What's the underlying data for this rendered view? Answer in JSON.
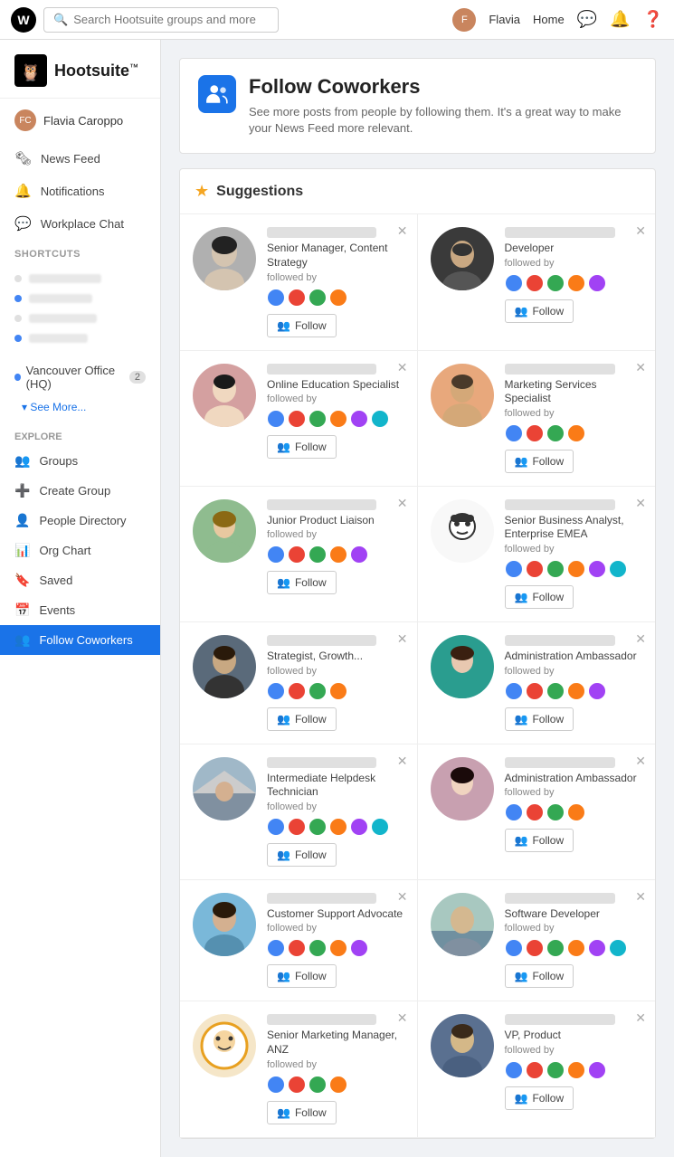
{
  "topNav": {
    "logoLetter": "W",
    "searchPlaceholder": "Search Hootsuite groups and more",
    "userName": "Flavia",
    "homeLabel": "Home"
  },
  "sidebar": {
    "logo": "Hootsuite",
    "logoTm": "™",
    "userName": "Flavia Caroppo",
    "navItems": [
      {
        "id": "news-feed",
        "label": "News Feed",
        "icon": "🗞"
      },
      {
        "id": "notifications",
        "label": "Notifications",
        "icon": "🔔"
      },
      {
        "id": "workplace-chat",
        "label": "Workplace Chat",
        "icon": "💬"
      }
    ],
    "shortcutsLabel": "Shortcuts",
    "officeGroup": {
      "label": "Vancouver Office (HQ)",
      "badge": "2",
      "seeMore": "See More..."
    },
    "exploreLabel": "Explore",
    "exploreItems": [
      {
        "id": "groups",
        "label": "Groups",
        "icon": "👥"
      },
      {
        "id": "create-group",
        "label": "Create Group",
        "icon": "➕"
      },
      {
        "id": "people-directory",
        "label": "People Directory",
        "icon": "👤"
      },
      {
        "id": "org-chart",
        "label": "Org Chart",
        "icon": "📊"
      },
      {
        "id": "saved",
        "label": "Saved",
        "icon": "🔖"
      },
      {
        "id": "events",
        "label": "Events",
        "icon": "📅"
      },
      {
        "id": "follow-coworkers",
        "label": "Follow Coworkers",
        "icon": "👥",
        "active": true
      }
    ]
  },
  "pageHeader": {
    "title": "Follow Coworkers",
    "description": "See more posts from people by following them. It's a great way to make your News Feed more relevant."
  },
  "suggestions": {
    "title": "Suggestions",
    "people": [
      {
        "id": 1,
        "title": "Senior Manager, Content Strategy",
        "followedBy": "followed by",
        "followLabel": "Follow"
      },
      {
        "id": 2,
        "title": "Developer",
        "followedBy": "followed by",
        "followLabel": "Follow"
      },
      {
        "id": 3,
        "title": "Online Education Specialist",
        "followedBy": "followed by",
        "followLabel": "Follow"
      },
      {
        "id": 4,
        "title": "Marketing Services Specialist",
        "followedBy": "followed by",
        "followLabel": "Follow"
      },
      {
        "id": 5,
        "title": "Junior Product Liaison",
        "followedBy": "followed by",
        "followLabel": "Follow"
      },
      {
        "id": 6,
        "title": "Senior Business Analyst, Enterprise EMEA",
        "followedBy": "followed by",
        "followLabel": "Follow"
      },
      {
        "id": 7,
        "title": "Strategist, Growth...",
        "followedBy": "followed by",
        "followLabel": "Follow"
      },
      {
        "id": 8,
        "title": "Administration Ambassador",
        "followedBy": "followed by",
        "followLabel": "Follow"
      },
      {
        "id": 9,
        "title": "Intermediate Helpdesk Technician",
        "followedBy": "followed by",
        "followLabel": "Follow"
      },
      {
        "id": 10,
        "title": "Administration Ambassador",
        "followedBy": "followed by",
        "followLabel": "Follow"
      },
      {
        "id": 11,
        "title": "Customer Support Advocate",
        "followedBy": "followed by",
        "followLabel": "Follow"
      },
      {
        "id": 12,
        "title": "Software Developer",
        "followedBy": "followed by",
        "followLabel": "Follow"
      },
      {
        "id": 13,
        "title": "Senior Marketing Manager, ANZ",
        "followedBy": "followed by",
        "followLabel": "Follow"
      },
      {
        "id": 14,
        "title": "VP, Product",
        "followedBy": "followed by",
        "followLabel": "Follow"
      }
    ]
  }
}
